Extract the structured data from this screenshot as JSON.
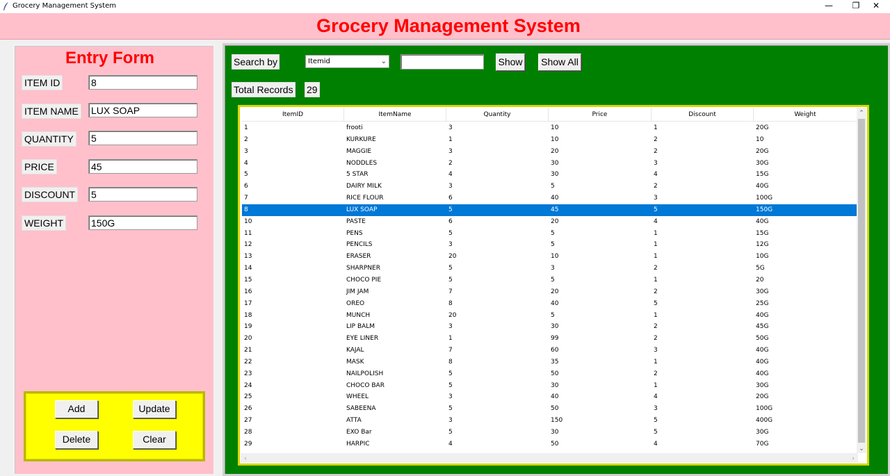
{
  "window": {
    "title": "Grocery Management System",
    "minimize_glyph": "—",
    "maximize_glyph": "❐",
    "close_glyph": "✕"
  },
  "header": {
    "heading": "Grocery Management System"
  },
  "entry_form": {
    "title": "Entry Form",
    "fields": [
      {
        "label": "ITEM ID",
        "value": "8"
      },
      {
        "label": "ITEM NAME",
        "value": "LUX SOAP"
      },
      {
        "label": "QUANTITY",
        "value": "5"
      },
      {
        "label": "PRICE",
        "value": "45"
      },
      {
        "label": "DISCOUNT",
        "value": "5"
      },
      {
        "label": "WEIGHT",
        "value": "150G"
      }
    ],
    "buttons": {
      "add": "Add",
      "update": "Update",
      "delete": "Delete",
      "clear": "Clear"
    }
  },
  "search": {
    "search_by_label": "Search by",
    "selected_field": "Itemid",
    "chevron_glyph": "⌄",
    "query": "",
    "show_button": "Show",
    "show_all_button": "Show All",
    "total_records_label": "Total Records",
    "total_records_value": "29"
  },
  "table": {
    "columns": [
      "ItemID",
      "ItemName",
      "Quantity",
      "Price",
      "Discount",
      "Weight"
    ],
    "selected_row_index": 7,
    "rows": [
      [
        "1",
        "frooti",
        "3",
        "10",
        "1",
        "20G"
      ],
      [
        "2",
        "KURKURE",
        "1",
        "10",
        "2",
        "10"
      ],
      [
        "3",
        "MAGGIE",
        "3",
        "20",
        "2",
        "20G"
      ],
      [
        "4",
        "NODDLES",
        "2",
        "30",
        "3",
        "30G"
      ],
      [
        "5",
        "5 STAR",
        "4",
        "30",
        "4",
        "15G"
      ],
      [
        "6",
        "DAIRY MILK",
        "3",
        "5",
        "2",
        "40G"
      ],
      [
        "7",
        "RICE FLOUR",
        "6",
        "40",
        "3",
        "100G"
      ],
      [
        "8",
        "LUX SOAP",
        "5",
        "45",
        "5",
        "150G"
      ],
      [
        "10",
        "PASTE",
        "6",
        "20",
        "4",
        "40G"
      ],
      [
        "11",
        "PENS",
        "5",
        "5",
        "1",
        "15G"
      ],
      [
        "12",
        "PENCILS",
        "3",
        "5",
        "1",
        "12G"
      ],
      [
        "13",
        "ERASER",
        "20",
        "10",
        "1",
        "10G"
      ],
      [
        "14",
        "SHARPNER",
        "5",
        "3",
        "2",
        "5G"
      ],
      [
        "15",
        "CHOCO PIE",
        "5",
        "5",
        "1",
        "20"
      ],
      [
        "16",
        "JIM JAM",
        "7",
        "20",
        "2",
        "30G"
      ],
      [
        "17",
        "OREO",
        "8",
        "40",
        "5",
        "25G"
      ],
      [
        "18",
        "MUNCH",
        "20",
        "5",
        "1",
        "40G"
      ],
      [
        "19",
        "LIP BALM",
        "3",
        "30",
        "2",
        "45G"
      ],
      [
        "20",
        "EYE LINER",
        "1",
        "99",
        "2",
        "50G"
      ],
      [
        "21",
        "KAJAL",
        "7",
        "60",
        "3",
        "40G"
      ],
      [
        "22",
        "MASK",
        "8",
        "35",
        "1",
        "40G"
      ],
      [
        "23",
        "NAILPOLISH",
        "5",
        "50",
        "2",
        "40G"
      ],
      [
        "24",
        "CHOCO BAR",
        "5",
        "30",
        "1",
        "30G"
      ],
      [
        "25",
        "WHEEL",
        "3",
        "40",
        "4",
        "20G"
      ],
      [
        "26",
        "SABEENA",
        "5",
        "50",
        "3",
        "100G"
      ],
      [
        "27",
        "ATTA",
        "3",
        "150",
        "5",
        "400G"
      ],
      [
        "28",
        "EXO Bar",
        "5",
        "30",
        "5",
        "30G"
      ],
      [
        "29",
        "HARPIC",
        "4",
        "50",
        "4",
        "70G"
      ]
    ]
  },
  "scrollbars": {
    "up_glyph": "⌃",
    "down_glyph": "⌄",
    "left_glyph": "‹",
    "right_glyph": "›"
  },
  "colors": {
    "header_bg": "#ffc0cb",
    "heading_text": "#ff0000",
    "right_panel_bg": "#008000",
    "button_box_bg": "#ffff00",
    "selection": "#0078d7"
  }
}
